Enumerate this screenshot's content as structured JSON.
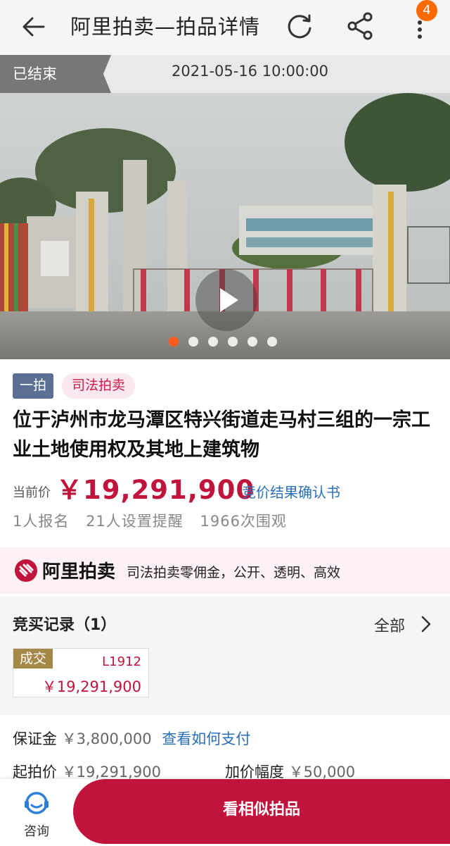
{
  "header": {
    "title": "阿里拍卖—拍品详情",
    "notification_count": "4",
    "icons": [
      "back-arrow-icon",
      "refresh-icon",
      "share-icon",
      "more-icon"
    ]
  },
  "status": {
    "label": "已结束",
    "end_time": "2021-05-16 10:00:00"
  },
  "gallery": {
    "image_count": 6,
    "active_index": 0
  },
  "lot": {
    "tag_round": "一拍",
    "tag_type": "司法拍卖",
    "title": "位于泸州市龙马潭区特兴街道走马村三组的一宗工业土地使用权及其地上建筑物",
    "price_label": "当前价",
    "price": "￥19,291,900",
    "confirm_link": "竞价结果确认书",
    "stats": [
      "1人报名",
      "21人设置提醒",
      "1966次围观"
    ]
  },
  "brand": {
    "name": "阿里拍卖",
    "slogan": "司法拍卖零佣金，公开、透明、高效"
  },
  "bids": {
    "heading": "竞买记录（1）",
    "all_label": "全部",
    "records": [
      {
        "status": "成交",
        "bidder": "L1912",
        "amount": "￥19,291,900"
      }
    ]
  },
  "terms": {
    "deposit_label": "保证金",
    "deposit_value": "￥3,800,000",
    "deposit_link": "查看如何支付",
    "start_label": "起拍价",
    "start_value": "￥19,291,900",
    "increment_label": "加价幅度",
    "increment_value": "￥50,000"
  },
  "bottom": {
    "consult_label": "咨询",
    "similar_label": "看相似拍品"
  },
  "colors": {
    "accent": "#c1143c",
    "link": "#2b6fb8",
    "badge": "#ff6a00"
  }
}
